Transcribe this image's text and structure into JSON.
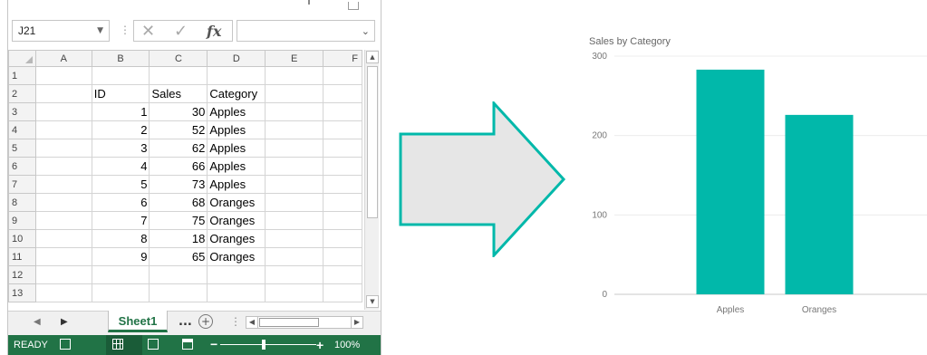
{
  "excel": {
    "name_box": "J21",
    "formula_value": "",
    "columns": [
      "A",
      "B",
      "C",
      "D",
      "E",
      "F"
    ],
    "rows": [
      {
        "num": "1",
        "A": "",
        "B": "",
        "C": "",
        "D": "",
        "E": ""
      },
      {
        "num": "2",
        "A": "",
        "B": "ID",
        "C": "Sales",
        "D": "Category",
        "E": ""
      },
      {
        "num": "3",
        "A": "",
        "B": "1",
        "C": "30",
        "D": "Apples",
        "E": ""
      },
      {
        "num": "4",
        "A": "",
        "B": "2",
        "C": "52",
        "D": "Apples",
        "E": ""
      },
      {
        "num": "5",
        "A": "",
        "B": "3",
        "C": "62",
        "D": "Apples",
        "E": ""
      },
      {
        "num": "6",
        "A": "",
        "B": "4",
        "C": "66",
        "D": "Apples",
        "E": ""
      },
      {
        "num": "7",
        "A": "",
        "B": "5",
        "C": "73",
        "D": "Apples",
        "E": ""
      },
      {
        "num": "8",
        "A": "",
        "B": "6",
        "C": "68",
        "D": "Oranges",
        "E": ""
      },
      {
        "num": "9",
        "A": "",
        "B": "7",
        "C": "75",
        "D": "Oranges",
        "E": ""
      },
      {
        "num": "10",
        "A": "",
        "B": "8",
        "C": "18",
        "D": "Oranges",
        "E": ""
      },
      {
        "num": "11",
        "A": "",
        "B": "9",
        "C": "65",
        "D": "Oranges",
        "E": ""
      },
      {
        "num": "12",
        "A": "",
        "B": "",
        "C": "",
        "D": "",
        "E": ""
      },
      {
        "num": "13",
        "A": "",
        "B": "",
        "C": "",
        "D": "",
        "E": ""
      }
    ],
    "sheet_tab": "Sheet1",
    "more_tabs": "...",
    "status": "READY",
    "zoom": "100%"
  },
  "colors": {
    "excel_green": "#217346",
    "chart_bar": "#01b8aa",
    "arrow_stroke": "#01b8aa",
    "arrow_fill": "#e6e6e6"
  },
  "chart_data": {
    "type": "bar",
    "title": "Sales by Category",
    "categories": [
      "Apples",
      "Oranges"
    ],
    "values": [
      283,
      226
    ],
    "ylim": [
      0,
      300
    ],
    "yticks": [
      0,
      100,
      200,
      300
    ],
    "grid": true,
    "xlabel": "",
    "ylabel": ""
  }
}
